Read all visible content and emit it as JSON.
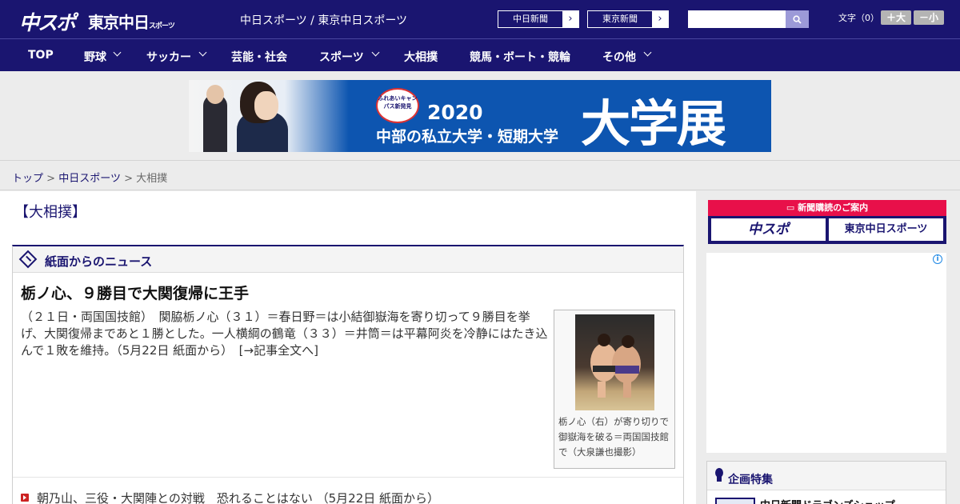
{
  "header": {
    "logo_chunichi": "中スポ",
    "logo_tokyo": "東京中日",
    "logo_tokyo_suffix": "スポーツ",
    "site_title": "中日スポーツ / 東京中日スポーツ",
    "ext_links": [
      "中日新聞",
      "東京新聞"
    ],
    "search_placeholder": "",
    "font_size_label": "文字（0）",
    "font_larger": "＋大",
    "font_smaller": "－小"
  },
  "nav": {
    "items": [
      {
        "label": "TOP",
        "dropdown": false
      },
      {
        "label": "野球",
        "dropdown": true
      },
      {
        "label": "サッカー",
        "dropdown": true
      },
      {
        "label": "芸能・社会",
        "dropdown": false
      },
      {
        "label": "スポーツ",
        "dropdown": true
      },
      {
        "label": "大相撲",
        "dropdown": false
      },
      {
        "label": "競馬・ボート・競輪",
        "dropdown": false
      },
      {
        "label": "その他",
        "dropdown": true
      }
    ]
  },
  "banner": {
    "badge": "ふれあいキャンパス新発見",
    "year": "2020",
    "sub": "中部の私立大学・短期大学",
    "big": "大学展"
  },
  "breadcrumb": {
    "home": "トップ",
    "sep": ">",
    "section": "中日スポーツ",
    "current": "大相撲"
  },
  "main": {
    "section_heading": "【大相撲】",
    "news_box_label": "紙面からのニュース",
    "headline": "栃ノ心、９勝目で大関復帰に王手",
    "lead": "（２１日・両国国技館）　関脇栃ノ心（３１）＝春日野＝は小結御嶽海を寄り切って９勝目を挙げ、大関復帰まであと１勝とした。一人横綱の鶴竜（３３）＝井筒＝は平幕阿炎を冷静にはたき込んで１敗を維持。（5月22日 紙面から）　",
    "read_more": "[→記事全文へ]",
    "photo_caption": "栃ノ心（右）が寄り切りで御嶽海を破る＝両国国技館で（大泉謙也撮影）",
    "list": [
      "朝乃山、三役・大関陣との対戦　恐れることはない （5月22日 紙面から）"
    ]
  },
  "sidebar": {
    "subscribe_head": "新聞購読のご案内",
    "subscribe_buttons": [
      "中スポ",
      "東京中日スポーツ"
    ],
    "ad_info": "i",
    "feature_head": "企画特集",
    "feature_item": "中日新聞ドラゴンズショップ"
  },
  "colors": {
    "brand": "#1a1570",
    "accent_red": "#e8104a",
    "banner_blue": "#0d55b0"
  }
}
